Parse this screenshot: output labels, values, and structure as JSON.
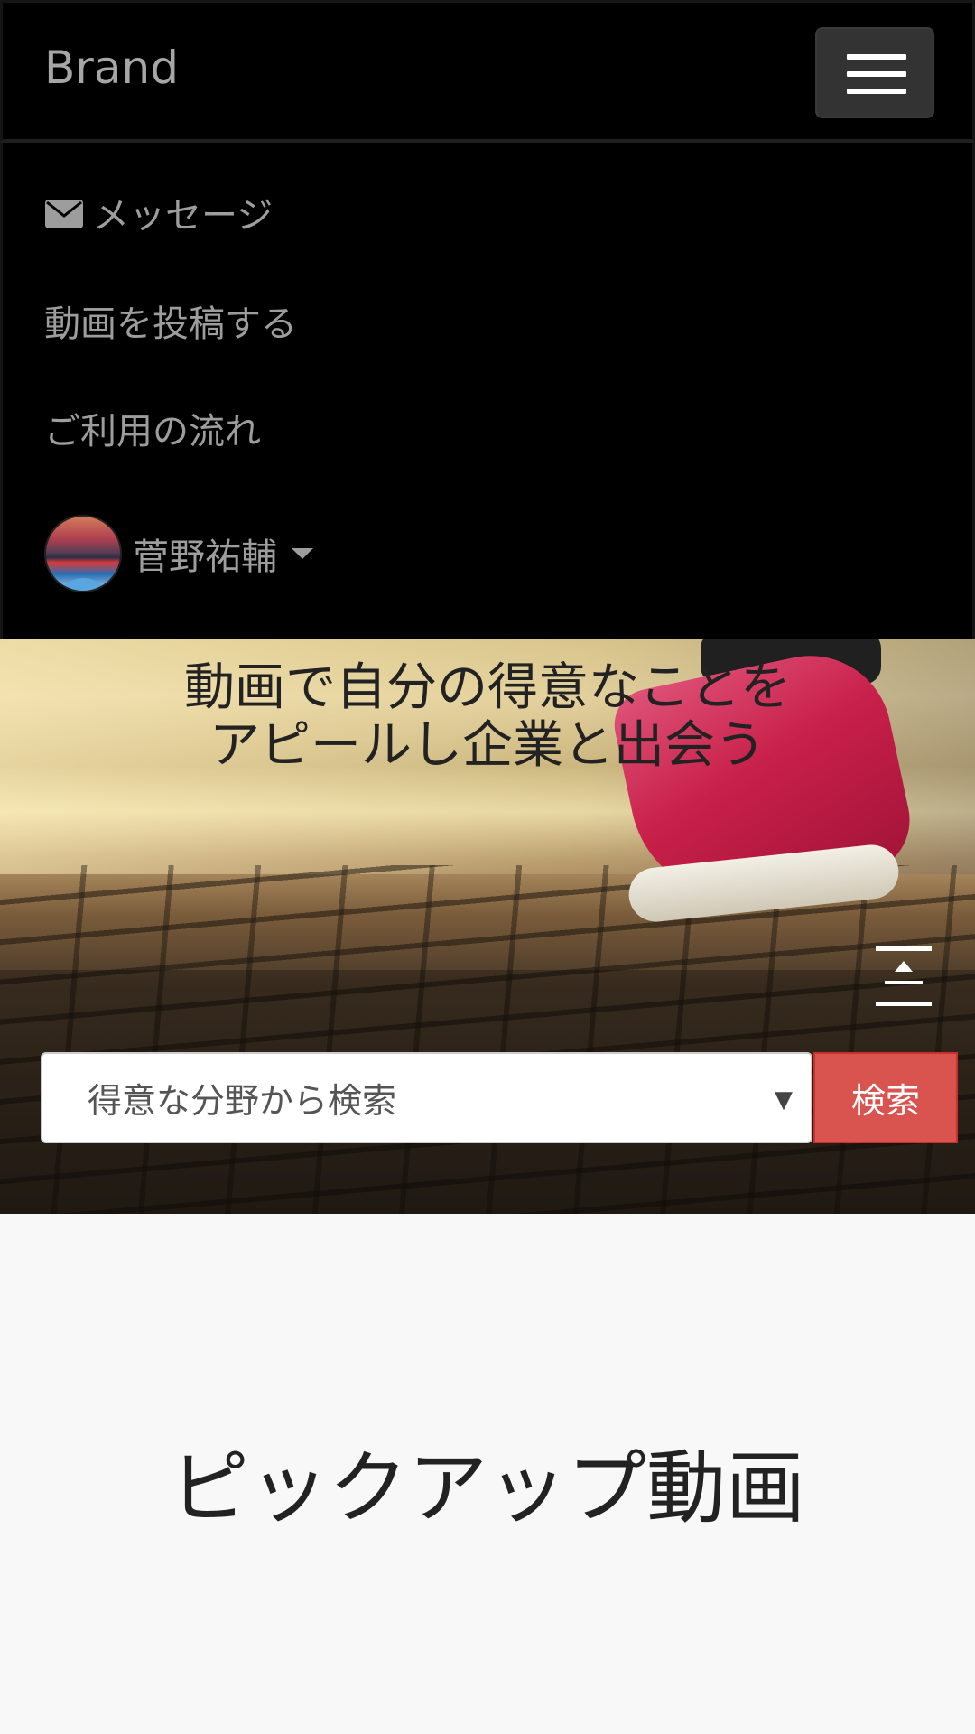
{
  "navbar": {
    "brand": "Brand",
    "toggle_icon": "hamburger-icon"
  },
  "menu": {
    "message_icon": "envelope-icon",
    "message": "メッセージ",
    "post_video": "動画を投稿する",
    "how_to_use": "ご利用の流れ",
    "user_name": "菅野祐輔",
    "user_caret_icon": "caret-down-icon"
  },
  "hero": {
    "title_line1": "動画で自分の得意なことを",
    "title_line2": "アピールし企業と出会う",
    "collapse_icon": "collapse-vertical-icon",
    "search_placeholder": "得意な分野から検索",
    "search_button": "検索"
  },
  "pickup": {
    "title": "ピックアップ動画"
  },
  "colors": {
    "navbar_bg": "#000000",
    "menu_text": "#9d9d9d",
    "search_button_bg": "#d9534f",
    "page_bg": "#f8f8f8"
  }
}
